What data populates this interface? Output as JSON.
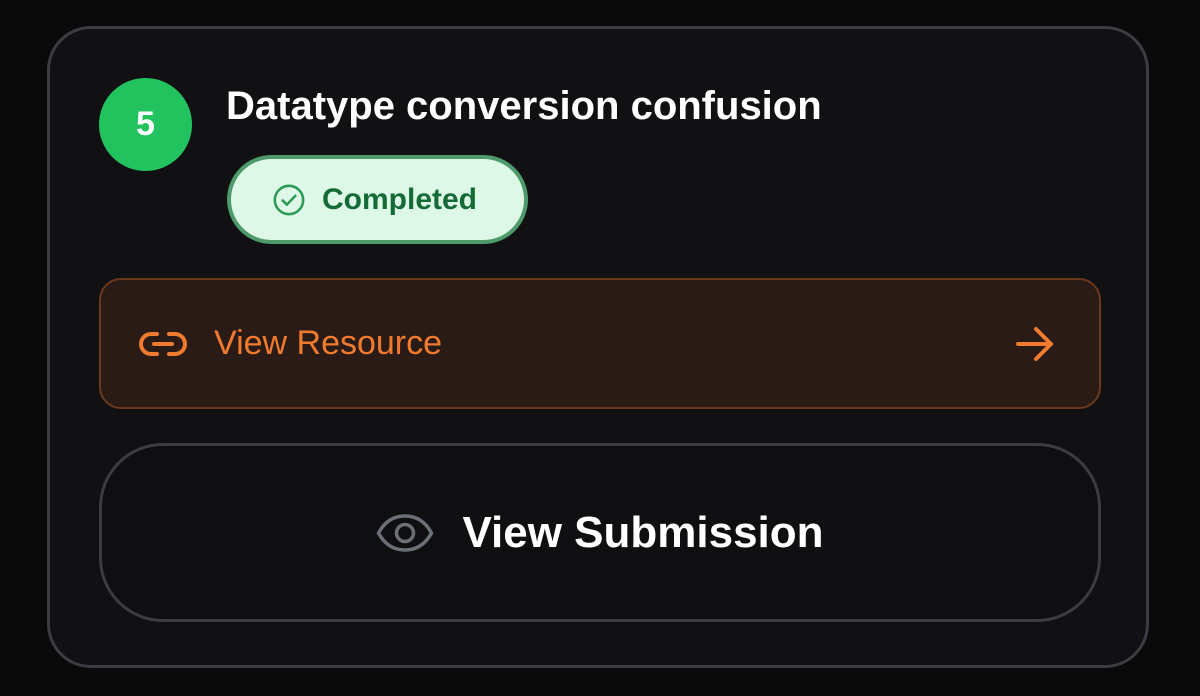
{
  "task": {
    "step_number": "5",
    "title": "Datatype conversion confusion",
    "status": {
      "label": "Completed",
      "icon": "check-circle-icon",
      "color": "#146b35",
      "background": "#ddf8e6"
    }
  },
  "actions": {
    "resource": {
      "label": "View Resource",
      "leading_icon": "link-icon",
      "trailing_icon": "arrow-right-icon",
      "color": "#f07a2d"
    },
    "submission": {
      "label": "View Submission",
      "icon": "eye-icon"
    }
  },
  "colors": {
    "accent_green": "#22c35e",
    "accent_orange": "#f07a2d",
    "card_background": "#111113"
  }
}
